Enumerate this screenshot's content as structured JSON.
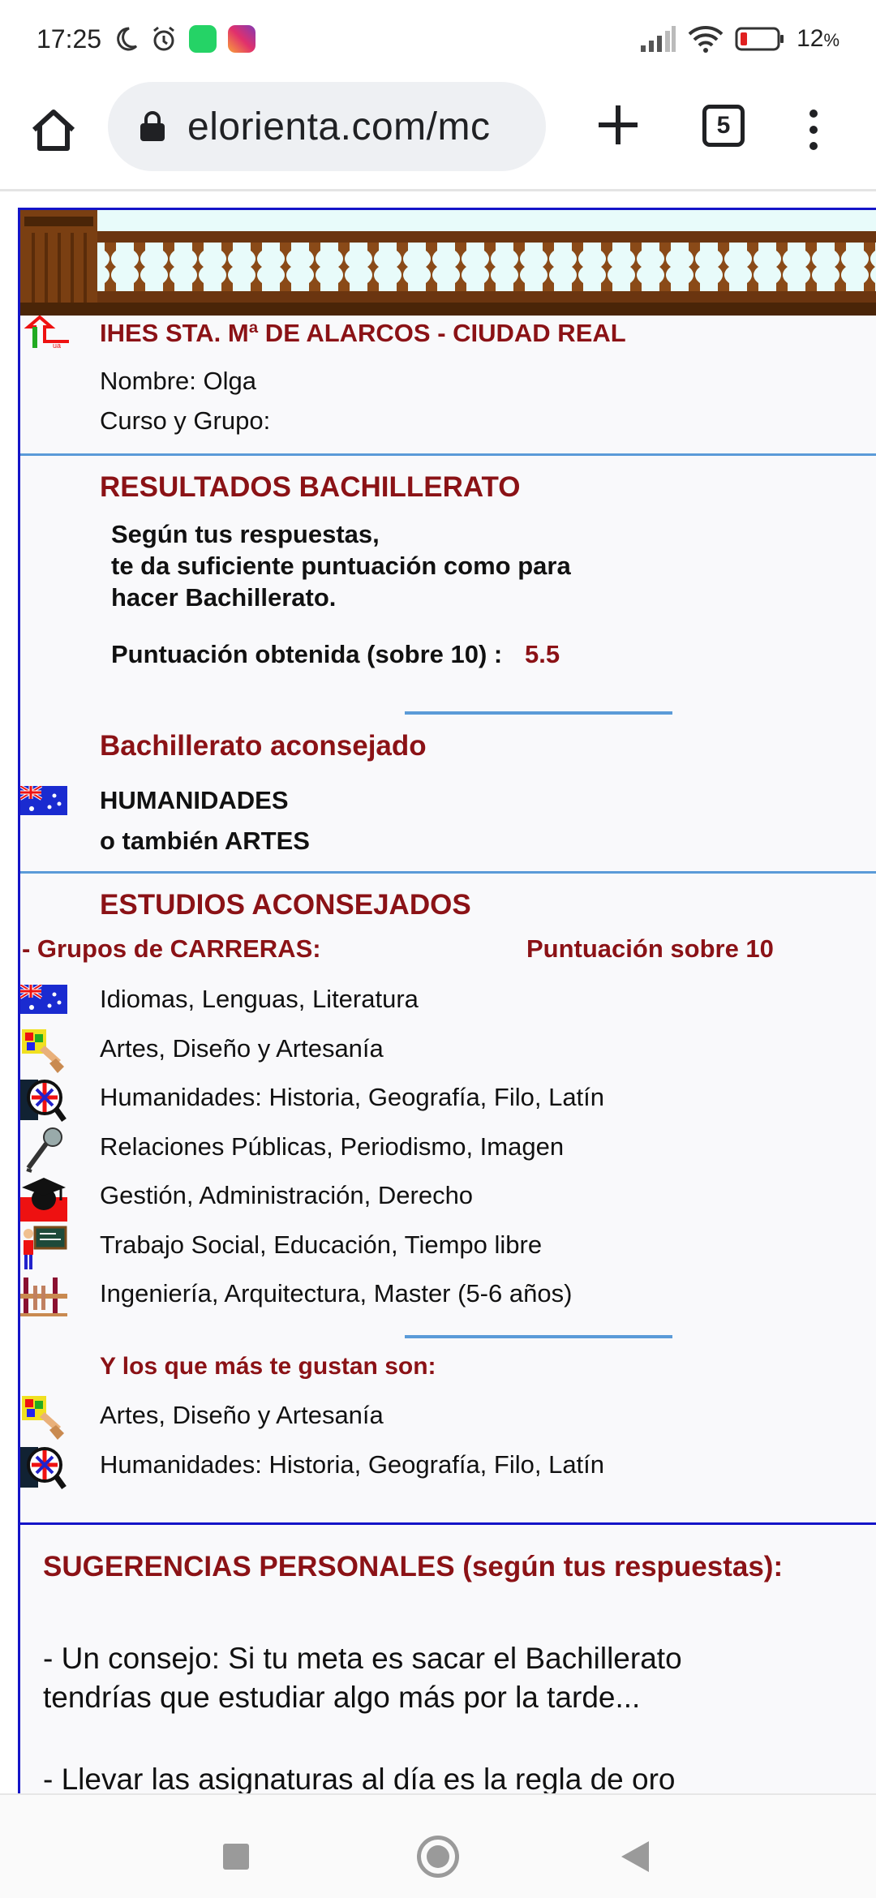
{
  "status_bar": {
    "time": "17:25",
    "battery_text": "12",
    "battery_unit": "%",
    "icons": [
      "moon-icon",
      "alarm-icon",
      "whatsapp-icon",
      "instagram-icon",
      "signal-icon",
      "wifi-icon",
      "battery-icon"
    ]
  },
  "browser": {
    "url": "elorienta.com/mc",
    "tab_count": "5",
    "icons": [
      "home-icon",
      "lock-icon",
      "new-tab-icon",
      "tabs-icon",
      "more-menu-icon"
    ]
  },
  "header": {
    "school": "IHES STA. Mª DE ALARCOS - CIUDAD REAL",
    "name_line": "Nombre: Olga",
    "course_line": "Curso y Grupo:"
  },
  "resultados": {
    "title": "RESULTADOS BACHILLERATO",
    "lines": [
      "Según tus respuestas,",
      "te da suficiente puntuación como para",
      "hacer Bachillerato."
    ],
    "score_label": "Puntuación obtenida (sobre 10) :",
    "score_value": "5.5"
  },
  "bachillerato": {
    "title": "Bachillerato aconsejado",
    "option1": "HUMANIDADES",
    "option2": "o también ARTES"
  },
  "estudios": {
    "title": "ESTUDIOS ACONSEJADOS",
    "groups_header": "- Grupos de CARRERAS:",
    "score_header": "Puntuación sobre 10",
    "items": [
      {
        "label": "Idiomas, Lenguas, Literatura",
        "icon": "flag-icon"
      },
      {
        "label": "Artes, Diseño y Artesanía",
        "icon": "palette-icon"
      },
      {
        "label": "Humanidades: Historia, Geografía, Filo, Latín",
        "icon": "humanities-icon"
      },
      {
        "label": "Relaciones Públicas, Periodismo, Imagen",
        "icon": "microphone-icon"
      },
      {
        "label": "Gestión, Administración, Derecho",
        "icon": "graduation-cap-icon"
      },
      {
        "label": "Trabajo Social, Educación, Tiempo libre",
        "icon": "teacher-icon"
      },
      {
        "label": "Ingeniería, Arquitectura, Master (5-6 años)",
        "icon": "engineering-icon"
      }
    ],
    "favorites_title": "Y los que más te gustan son:",
    "favorites": [
      {
        "label": "Artes, Diseño y Artesanía",
        "icon": "palette-icon"
      },
      {
        "label": "Humanidades: Historia, Geografía, Filo, Latín",
        "icon": "humanities-icon"
      }
    ]
  },
  "sugerencias": {
    "title": "SUGERENCIAS PERSONALES (según tus respuestas):",
    "tip1_line1": "- Un consejo: Si tu meta es sacar el Bachillerato",
    "tip1_line2": "tendrías que estudiar algo más por la tarde...",
    "tip2_line1": "- Llevar las asignaturas al día es la regla de oro"
  },
  "colors": {
    "accent": "#8b1216",
    "page_border": "#1414c8",
    "divider": "#5b9bd8"
  }
}
